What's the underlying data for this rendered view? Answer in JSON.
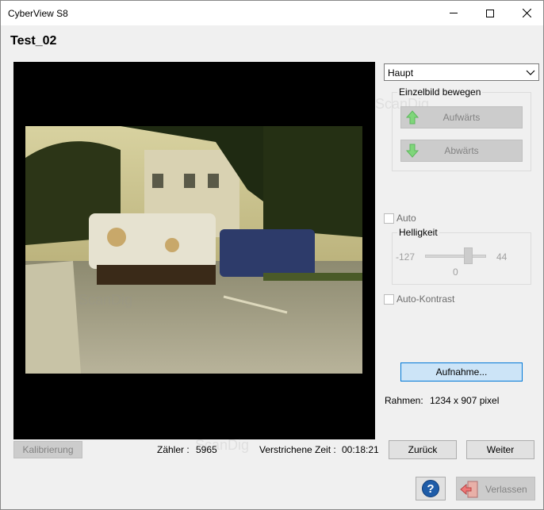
{
  "window": {
    "title": "CyberView S8"
  },
  "heading": "Test_02",
  "mode_select": {
    "value": "Haupt"
  },
  "move_group": {
    "legend": "Einzelbild bewegen",
    "up_label": "Aufwärts",
    "down_label": "Abwärts"
  },
  "auto": {
    "label": "Auto",
    "checked": false
  },
  "brightness": {
    "legend": "Helligkeit",
    "min": "-127",
    "max": "44",
    "value": "0"
  },
  "auto_contrast": {
    "label": "Auto-Kontrast",
    "checked": false
  },
  "capture_button": "Aufnahme...",
  "frame_info": {
    "label": "Rahmen:",
    "value": "1234 x 907 pixel"
  },
  "bottom": {
    "calibrate_label": "Kalibrierung",
    "counter_label": "Zähler :",
    "counter_value": "5965",
    "elapsed_label": "Verstrichene Zeit :",
    "elapsed_value": "00:18:21",
    "back_label": "Zurück",
    "next_label": "Weiter",
    "help_glyph": "?",
    "exit_label": "Verlassen"
  },
  "watermark": "ScanDig",
  "colors": {
    "accent": "#0078d7",
    "capture_bg": "#cce4f7",
    "help_blue": "#1e5ca8",
    "arrow_green": "#7fd67a"
  },
  "icons": [
    "minimize-icon",
    "maximize-icon",
    "close-icon",
    "chevron-down-icon",
    "arrow-up-icon",
    "arrow-down-icon",
    "help-icon",
    "exit-door-icon"
  ]
}
